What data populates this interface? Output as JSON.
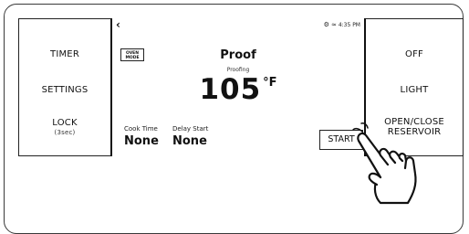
{
  "left_panel": {
    "timer": "TIMER",
    "settings": "SETTINGS",
    "lock": "LOCK",
    "lock_sub": "(3sec)"
  },
  "screen": {
    "back_icon": "chevron-left-icon",
    "status_icons": [
      "settings-icon",
      "wifi-icon"
    ],
    "time": "4:35 PM",
    "oven_mode_badge": "OVEN MODE",
    "mode_title": "Proof",
    "mode_sub": "Proofing",
    "temperature": "105",
    "temperature_unit": "°F",
    "cook_time_label": "Cook Time",
    "cook_time_value": "None",
    "delay_start_label": "Delay Start",
    "delay_start_value": "None",
    "start_label": "START"
  },
  "right_panel": {
    "off": "OFF",
    "light": "LIGHT",
    "open_close_line1": "OPEN/CLOSE",
    "open_close_line2": "RESERVOIR"
  },
  "pointer": "hand-pointer-icon"
}
